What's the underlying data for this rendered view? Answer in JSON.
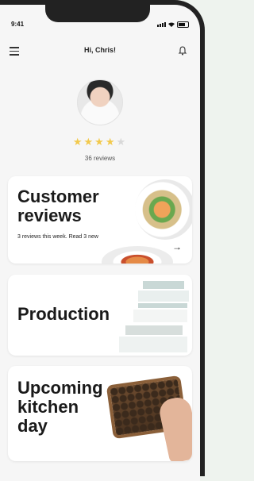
{
  "status": {
    "time": "9:41"
  },
  "header": {
    "greeting": "Hi, Chris!"
  },
  "profile": {
    "rating": 4,
    "max_rating": 5,
    "reviews_label": "36 reviews"
  },
  "cards": [
    {
      "title_lines": [
        "Customer",
        "reviews"
      ],
      "subtitle": "3 reviews this week. Read 3 new",
      "has_arrow": true,
      "arrow": "→"
    },
    {
      "title_lines": [
        "Production"
      ]
    },
    {
      "title_lines": [
        "Upcoming",
        "kitchen",
        "day"
      ]
    }
  ]
}
